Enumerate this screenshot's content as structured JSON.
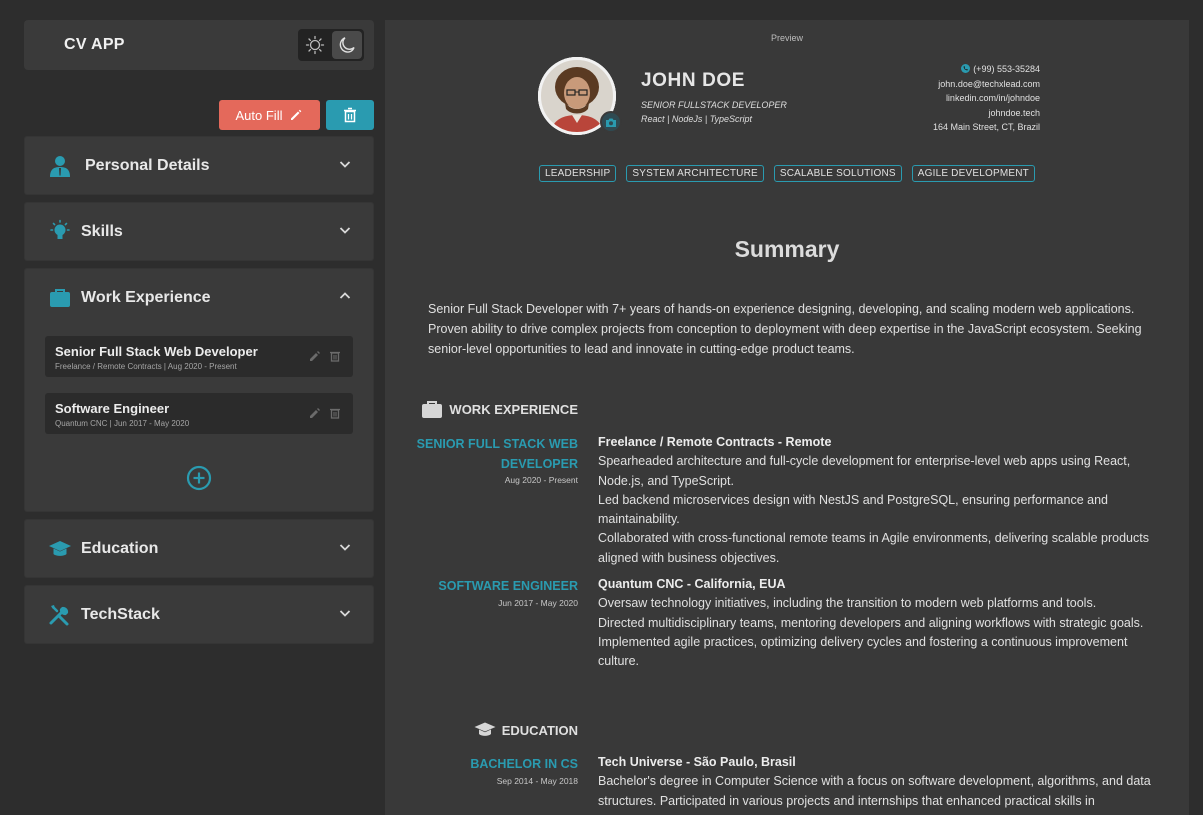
{
  "app": {
    "title": "CV APP"
  },
  "theme": {
    "light_icon": "sun-icon",
    "dark_icon": "moon-icon",
    "active": "dark"
  },
  "actions": {
    "autofill_label": "Auto Fill",
    "clear_icon": "trash-icon"
  },
  "colors": {
    "accent": "#2a9bb0",
    "autofill": "#e4695b"
  },
  "sections": {
    "personal": {
      "label": "Personal Details",
      "icon": "person-icon"
    },
    "skills": {
      "label": "Skills",
      "icon": "lightbulb-icon"
    },
    "work": {
      "label": "Work Experience",
      "icon": "briefcase-icon",
      "items": [
        {
          "title": "Senior Full Stack Web Developer",
          "sub": "Freelance / Remote Contracts | Aug 2020 - Present"
        },
        {
          "title": "Software Engineer",
          "sub": "Quantum CNC | Jun 2017 - May 2020"
        }
      ]
    },
    "education": {
      "label": "Education",
      "icon": "graduation-cap-icon"
    },
    "techstack": {
      "label": "TechStack",
      "icon": "tools-icon"
    }
  },
  "preview": {
    "label": "Preview",
    "name": "JOHN DOE",
    "role": "SENIOR FULLSTACK DEVELOPER",
    "stack": "React | NodeJs | TypeScript",
    "contact": {
      "phone": "(+99) 553-35284",
      "email": "john.doe@techxlead.com",
      "linkedin": "linkedin.com/in/johndoe",
      "site": "johndoe.tech",
      "address": "164 Main Street, CT, Brazil"
    },
    "tags": [
      "LEADERSHIP",
      "SYSTEM ARCHITECTURE",
      "SCALABLE SOLUTIONS",
      "AGILE DEVELOPMENT"
    ],
    "summary_title": "Summary",
    "summary": "Senior Full Stack Developer with 7+ years of hands-on experience designing, developing, and scaling modern web applications. Proven ability to drive complex projects from conception to deployment with deep expertise in the JavaScript ecosystem. Seeking senior-level opportunities to lead and innovate in cutting-edge product teams.",
    "work_heading": "WORK EXPERIENCE",
    "work": [
      {
        "role_line1": "SENIOR FULL STACK WEB",
        "role_line2": "DEVELOPER",
        "dates": "Aug 2020 - Present",
        "company": "Freelance / Remote Contracts - Remote",
        "bullets": [
          "Spearheaded architecture and full-cycle development for enterprise-level web apps using React, Node.js, and TypeScript.",
          "Led backend microservices design with NestJS and PostgreSQL, ensuring performance and maintainability.",
          "Collaborated with cross-functional remote teams in Agile environments, delivering scalable products aligned with business objectives."
        ]
      },
      {
        "role_line1": "SOFTWARE ENGINEER",
        "dates": "Jun 2017 - May 2020",
        "company": "Quantum CNC - California, EUA",
        "bullets": [
          "Oversaw technology initiatives, including the transition to modern web platforms and tools.",
          "Directed multidisciplinary teams, mentoring developers and aligning workflows with strategic goals.",
          "Implemented agile practices, optimizing delivery cycles and fostering a continuous improvement culture."
        ]
      }
    ],
    "education_heading": "EDUCATION",
    "education": [
      {
        "degree": "BACHELOR IN CS",
        "dates": "Sep 2014 - May 2018",
        "school": "Tech Universe - São Paulo, Brasil",
        "description": "Bachelor's degree in Computer Science with a focus on software development, algorithms, and data structures. Participated in various projects and internships that enhanced practical skills in"
      }
    ]
  }
}
